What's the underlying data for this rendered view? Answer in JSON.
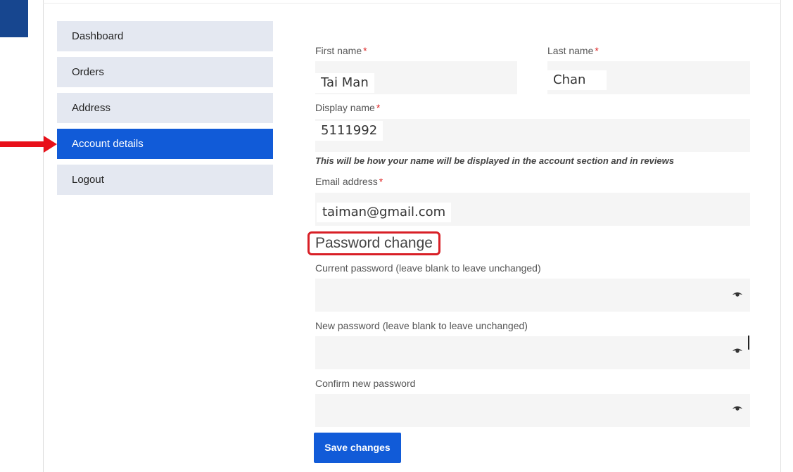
{
  "nav": {
    "items": [
      {
        "label": "Dashboard"
      },
      {
        "label": "Orders"
      },
      {
        "label": "Address"
      },
      {
        "label": "Account details"
      },
      {
        "label": "Logout"
      }
    ]
  },
  "form": {
    "required_mark": "*",
    "first_name": {
      "label": "First name",
      "value": "Tai Man"
    },
    "last_name": {
      "label": "Last name",
      "value": "Chan"
    },
    "display_name": {
      "label": "Display name",
      "value": "5111992"
    },
    "display_hint": "This will be how your name will be displayed in the account section and in reviews",
    "email": {
      "label": "Email address",
      "value": "taiman@gmail.com"
    },
    "password_section_title": "Password change",
    "current_password": {
      "label": "Current password (leave blank to leave unchanged)",
      "value": ""
    },
    "new_password": {
      "label": "New password (leave blank to leave unchanged)",
      "value": ""
    },
    "confirm_password": {
      "label": "Confirm new password",
      "value": ""
    },
    "save_label": "Save changes"
  },
  "colors": {
    "accent": "#115bd8",
    "highlight": "#d81f26",
    "nav_bg": "#e4e8f1",
    "input_bg": "#f5f5f5"
  },
  "icons": {
    "password_toggle": "eye-icon",
    "annotation": "red-arrow-icon"
  }
}
